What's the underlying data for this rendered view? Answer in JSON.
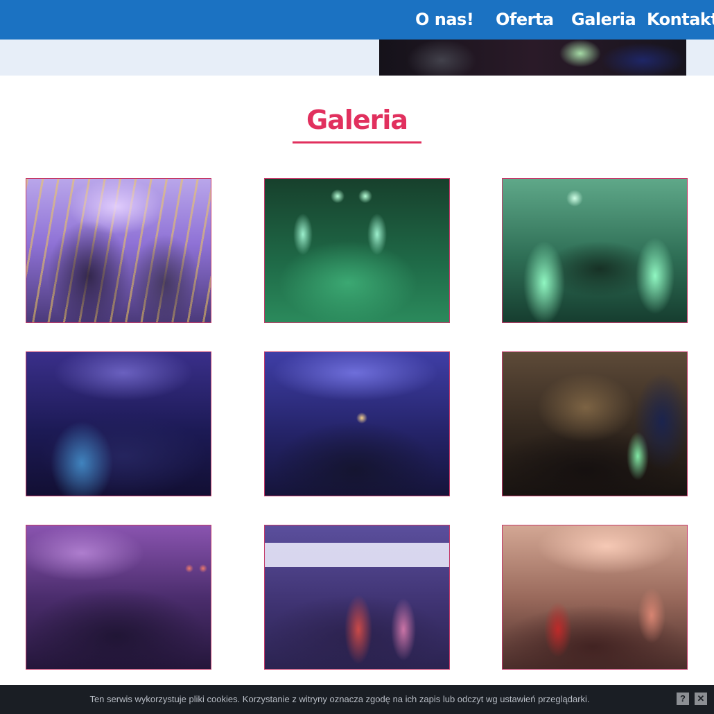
{
  "nav": {
    "items": [
      {
        "label": "O nas!"
      },
      {
        "label": "Oferta"
      },
      {
        "label": "Galeria"
      },
      {
        "label": "Kontakt"
      }
    ]
  },
  "main": {
    "title": "Galeria"
  },
  "cookie": {
    "text": "Ten serwis wykorzystuje pliki cookies. Korzystanie z witryny oznacza zgodę na ich zapis lub odczyt wg ustawień przeglądarki.",
    "help_label": "?",
    "close_label": "✕"
  },
  "colors": {
    "nav_bg": "#1b72c2",
    "accent": "#e1305e",
    "cookie_bg": "#1a1e24"
  }
}
